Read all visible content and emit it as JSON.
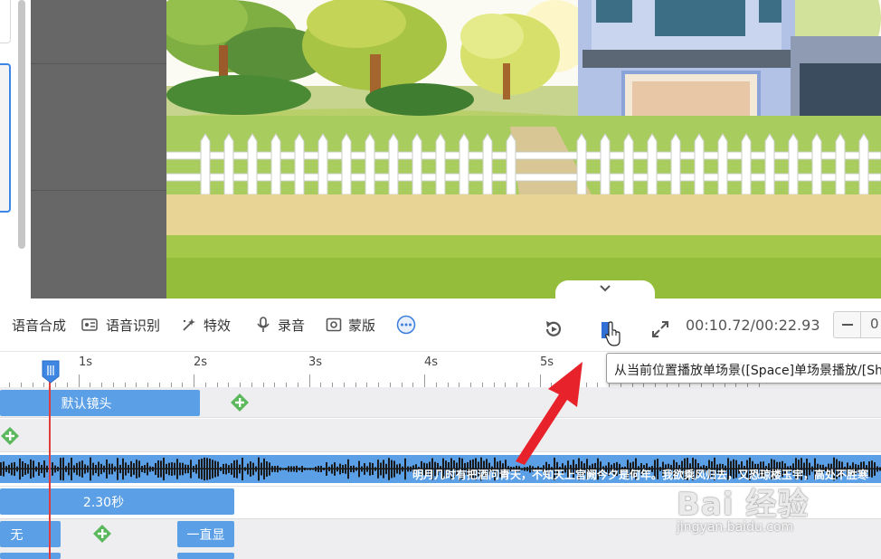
{
  "toolbar": {
    "items": [
      {
        "label": "语音合成",
        "icon": "tts-icon"
      },
      {
        "label": "语音识别",
        "icon": "speech-recognition-icon"
      },
      {
        "label": "特效",
        "icon": "effects-icon"
      },
      {
        "label": "录音",
        "icon": "microphone-icon"
      },
      {
        "label": "蒙版",
        "icon": "mask-icon"
      }
    ],
    "more_icon": "more-icon",
    "replay_icon": "replay-icon",
    "play_icon": "play-scene-icon",
    "fullscreen_icon": "fullscreen-icon",
    "timecode": "00:10.72/00:22.93",
    "zoom_char": "0"
  },
  "ruler": {
    "labels": [
      "1s",
      "2s",
      "3s",
      "4s",
      "5s"
    ]
  },
  "tooltip": {
    "text": "从当前位置播放单场景([Space]单场景播放/[Shift+Space]全场景播放)"
  },
  "tracks": {
    "camera_clip": "默认镜头",
    "audio_text": "明月几时有把酒问青天，不知天上宫阙今夕是何年。我欲乘风归去，又恐琼楼玉宇，高处不胜寒",
    "duration_clip": "2.30秒",
    "enter_clip": "无",
    "exit_clip": "一直显"
  },
  "colors": {
    "accent": "#5b9fe6",
    "playhead": "#e23b3b",
    "add": "#5cb85c"
  },
  "watermark": {
    "main": "Bai 经验",
    "sub": "jingyan.baidu.com"
  }
}
